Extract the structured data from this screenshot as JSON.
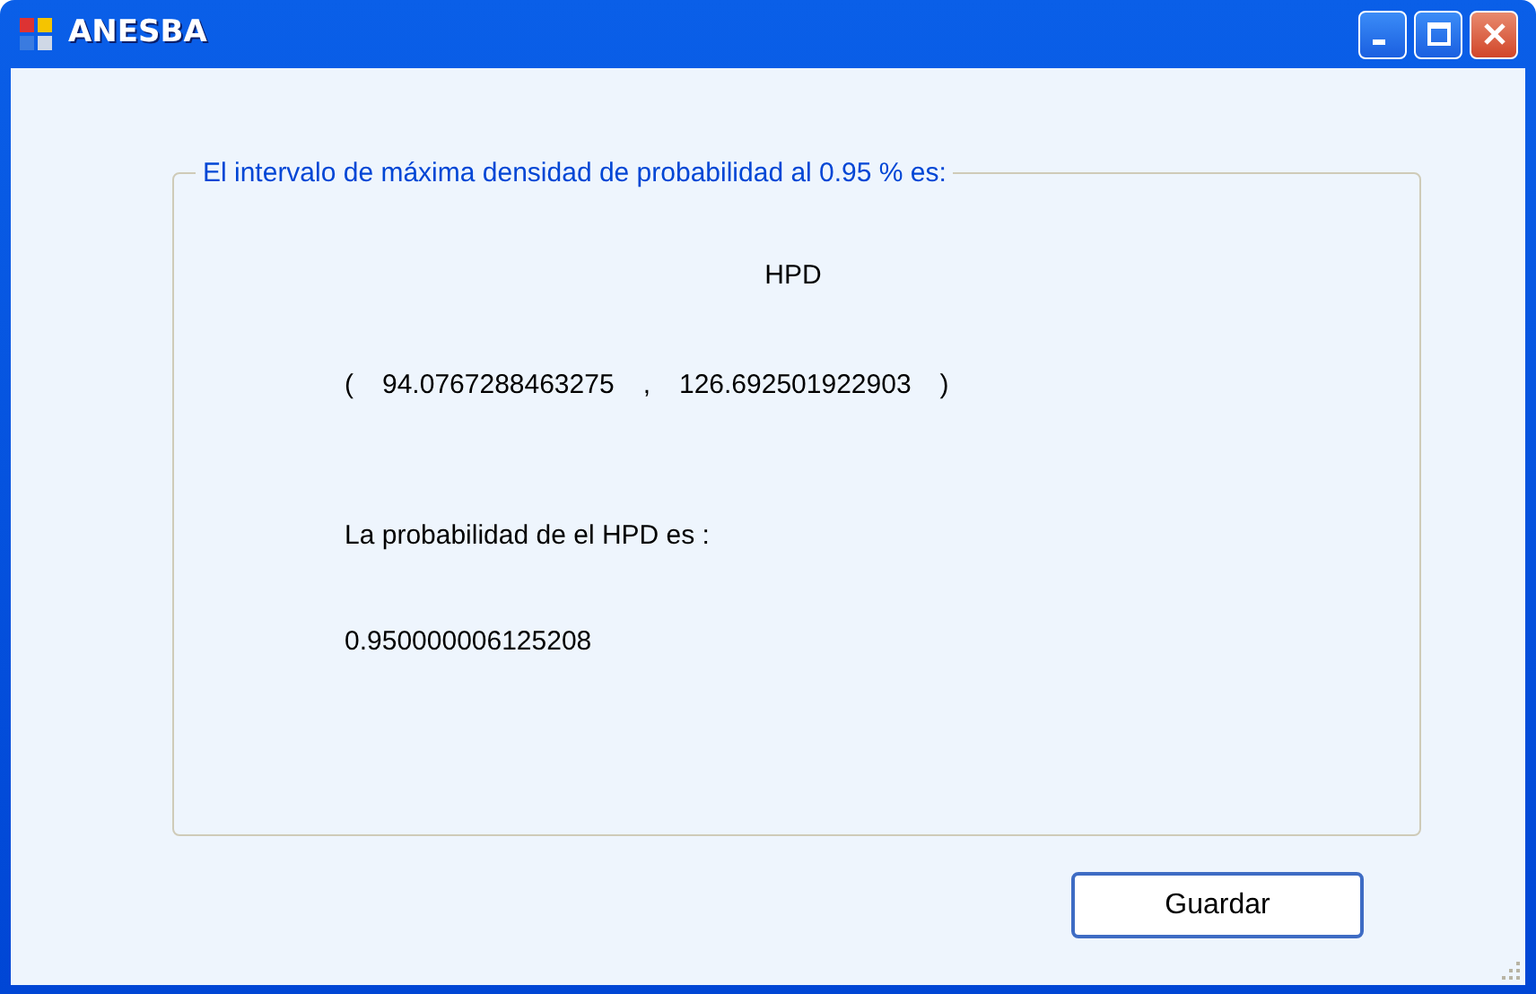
{
  "window": {
    "title": "ANESBA"
  },
  "group": {
    "legend": "El intervalo de máxima densidad de probabilidad al 0.95 % es:",
    "heading": "HPD",
    "interval": {
      "open": "(",
      "lower": "94.0767288463275",
      "separator": ",",
      "upper": "126.692501922903",
      "close": ")"
    },
    "probability_label": "La probabilidad de el HPD es :",
    "probability_value": "0.950000006125208"
  },
  "buttons": [
    "Guardar"
  ]
}
